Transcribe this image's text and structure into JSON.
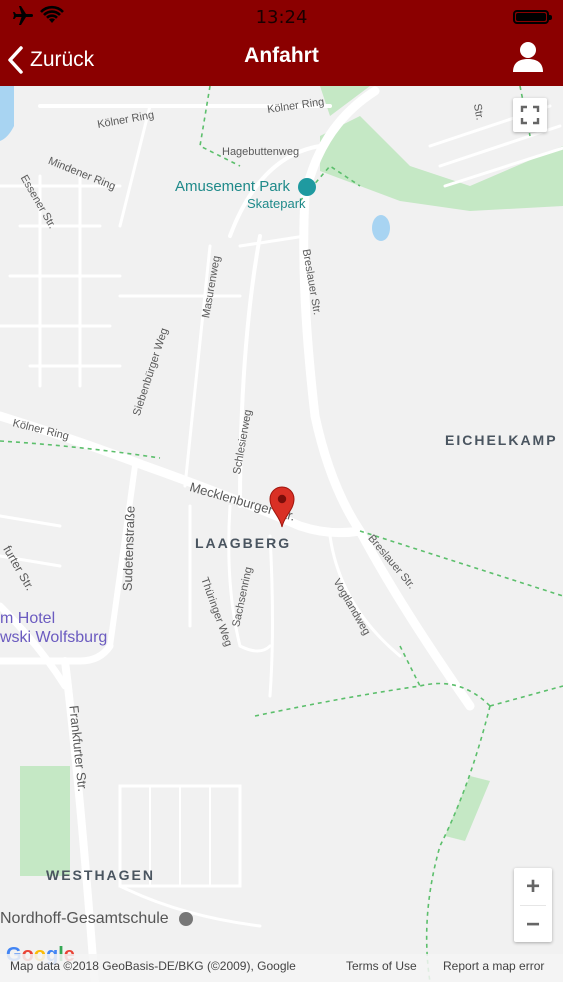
{
  "status_bar": {
    "time": "13:24",
    "icons": [
      "airplane-icon",
      "wifi-icon",
      "battery-icon"
    ]
  },
  "navbar": {
    "back_label": "Zurück",
    "title": "Anfahrt",
    "user_icon": "user-icon"
  },
  "colors": {
    "brand": "#8b0000",
    "park_green": "#c5e8c5",
    "poi_teal": "#1f8a8a",
    "marker_red": "#d93025"
  },
  "map": {
    "poi": {
      "name": "Amusement Park",
      "subtitle": "Skatepark"
    },
    "hotel": {
      "line1": "m Hotel",
      "line2": "wski Wolfsburg"
    },
    "school": "Nordhoff-Gesamtschule",
    "areas": {
      "eichelkamp": "EICHELKAMP",
      "laagberg": "LAAGBERG",
      "westhagen": "WESTHAGEN"
    },
    "streets": {
      "koelner_ring_top": "Kölner Ring",
      "hagebuttenweg": "Hagebuttenweg",
      "mindener_ring": "Mindener Ring",
      "essener_str": "Essener Str.",
      "masurenweg": "Masurenweg",
      "siebenbuerger_weg": "Siebenbürger Weg",
      "breslauer_str_top": "Breslauer Str.",
      "schlesierweg": "Schlesierweg",
      "koelner_ring_left": "Kölner Ring",
      "mecklenburger_str": "Mecklenburger Str.",
      "breslauer_str_bottom": "Breslauer Str.",
      "sudetenstrasse": "Sudetenstraße",
      "frankfurter_str_top": "furter Str.",
      "thueringer_weg": "Thüringer Weg",
      "sachsenring": "Sachsenring",
      "vogtlandweg": "Vogtlandweg",
      "frankfurter_str_bottom": "Frankfurter Str.",
      "top_right_str": "Str."
    },
    "controls": {
      "zoom_in": "+",
      "zoom_out": "−"
    },
    "footer": {
      "logo": "Google",
      "attribution": "Map data ©2018 GeoBasis-DE/BKG (©2009), Google",
      "terms": "Terms of Use",
      "report": "Report a map error"
    }
  }
}
